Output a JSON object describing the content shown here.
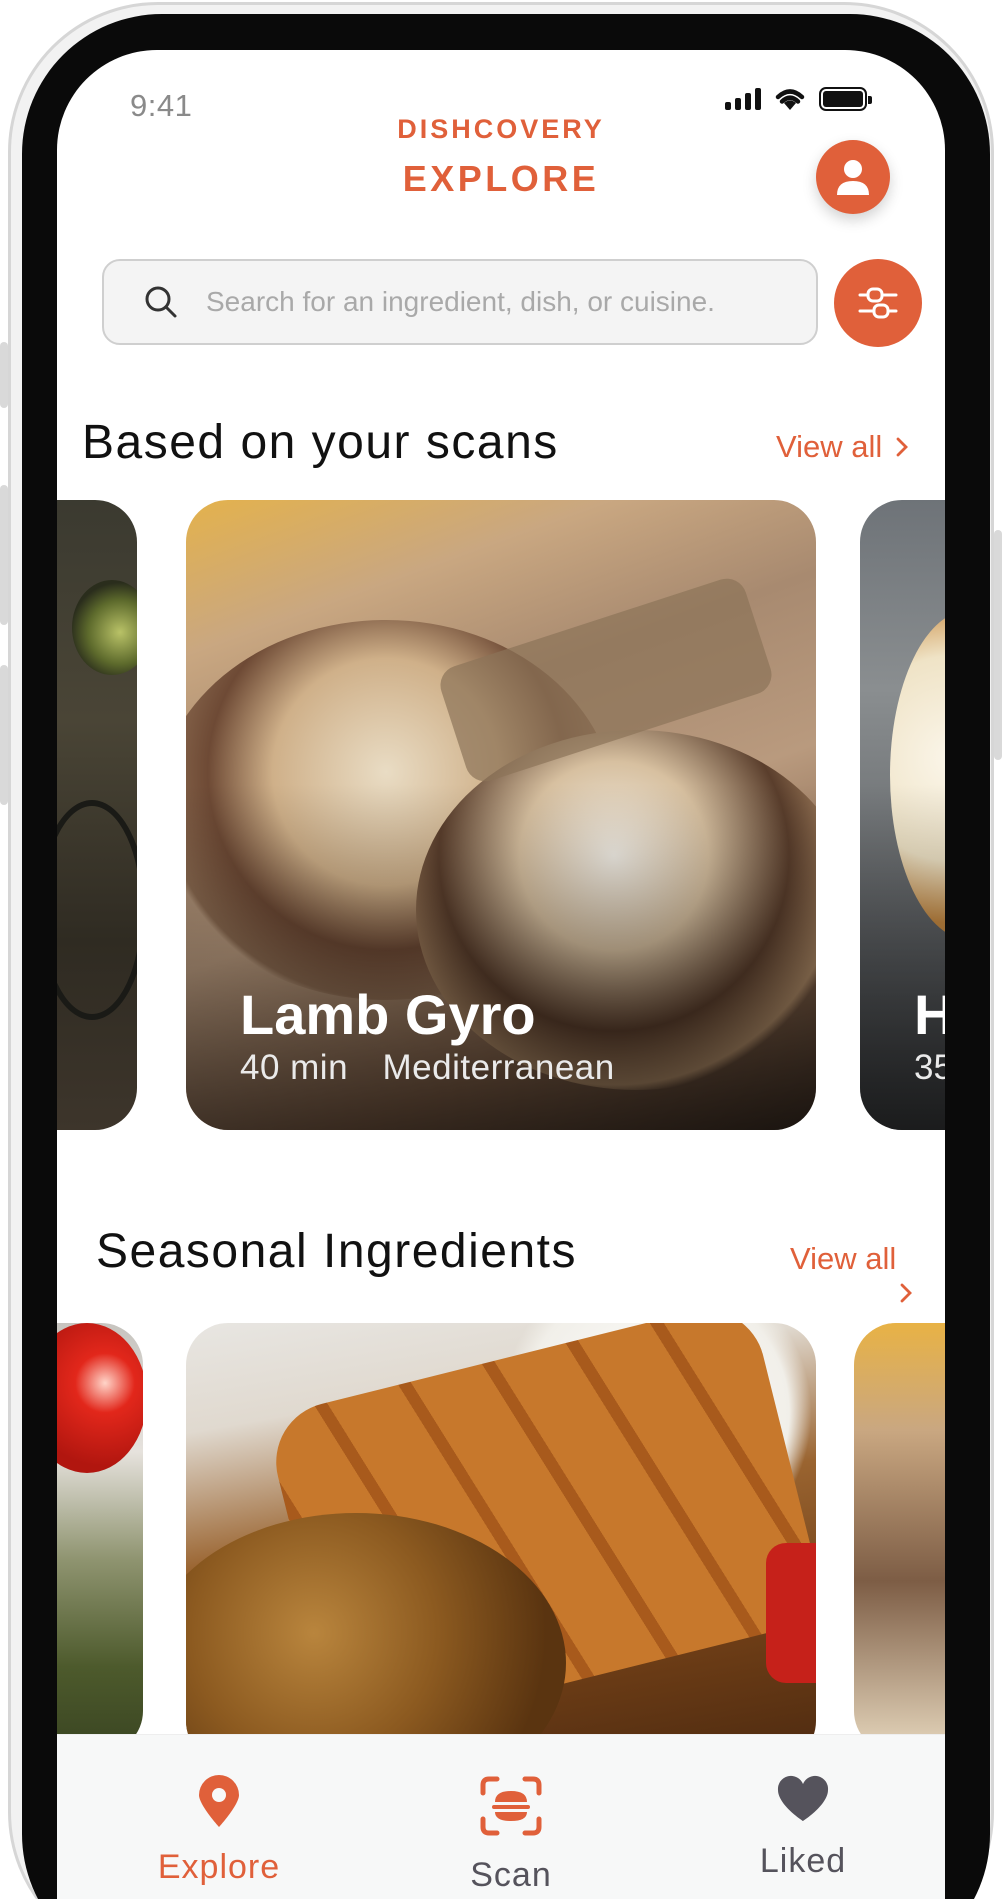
{
  "status_bar": {
    "time": "9:41"
  },
  "header": {
    "brand": "DISHCOVERY",
    "title": "EXPLORE"
  },
  "search": {
    "placeholder": "Search for an ingredient, dish, or cuisine."
  },
  "sections": {
    "scans": {
      "title": "Based on your scans",
      "view_all": "View all",
      "featured": {
        "name": "Lamb Gyro",
        "time": "40 min",
        "cuisine": "Mediterranean"
      },
      "peek_right": {
        "name": "H",
        "time": "35"
      }
    },
    "seasonal": {
      "title": "Seasonal Ingredients",
      "view_all": "View all"
    }
  },
  "tabs": [
    {
      "label": "Explore",
      "icon": "location-pin-icon",
      "active": true
    },
    {
      "label": "Scan",
      "icon": "scan-icon",
      "active": false
    },
    {
      "label": "Liked",
      "icon": "heart-icon",
      "active": false
    }
  ],
  "colors": {
    "accent": "#e0603a",
    "text": "#111111",
    "muted": "#a9a9a9",
    "inactive_tab": "#55535c"
  }
}
